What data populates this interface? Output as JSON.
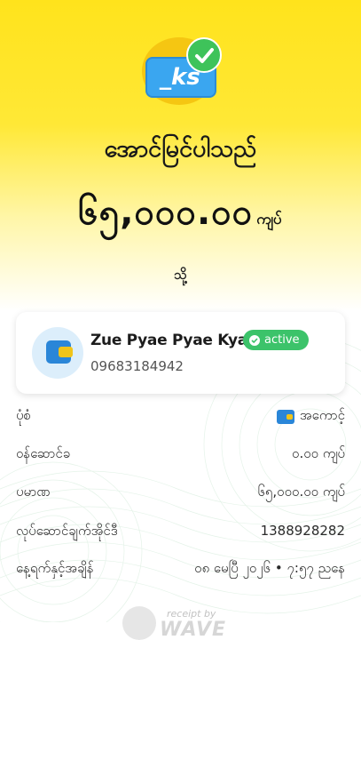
{
  "header": {
    "title": "အောင်မြင်ပါသည်",
    "amount": "၆၅,၀၀၀.၀၀",
    "amount_unit": "ကျပ်",
    "to_label": "သို့",
    "badge_text": "_ks"
  },
  "recipient": {
    "name": "Zue Pyae Pyae Kyaw",
    "status": "active",
    "phone": "09683184942"
  },
  "details": [
    {
      "label": "ပုံစံ",
      "value": "အကောင့်"
    },
    {
      "label": "ဝန်ဆောင်ခ",
      "value": "၀.၀၀ ကျပ်"
    },
    {
      "label": "ပမာဏ",
      "value": "၆၅,၀၀၀.၀၀ ကျပ်"
    },
    {
      "label": "လုပ်ဆောင်ချက်အိုင်ဒီ",
      "value": "1388928282"
    },
    {
      "label": "နေ့ရက်နှင့်အချိန်",
      "value": "၀၈ မေပြီ ၂၀၂၆ • ၇:၅၇ ညနေ"
    }
  ],
  "footer": {
    "receipt_by": "receipt by",
    "brand": "WAVE"
  },
  "colors": {
    "brand_yellow": "#ffe31c",
    "active_green": "#3cc36a",
    "wallet_blue": "#2a86d8"
  }
}
